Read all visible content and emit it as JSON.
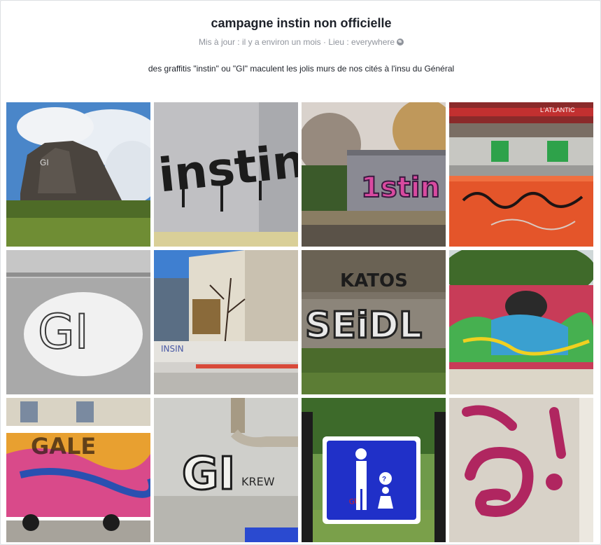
{
  "group": {
    "title": "campagne instin non officielle",
    "meta_updated": "Mis à jour : il y a environ un mois",
    "meta_separator": " · ",
    "meta_location": "Lieu : everywhere",
    "location_icon": "globe-icon",
    "description": "des graffitis \"instin\" ou \"GI\" maculent les jolis murs de nos cités à l'insu du Général"
  },
  "photos": {
    "p1": {
      "subject": "rock"
    },
    "p2": {
      "subject": "tag-instin",
      "tag": "instin"
    },
    "p3": {
      "subject": "wall-piece",
      "tag": "1stin"
    },
    "p4": {
      "subject": "barrier",
      "sign": "L'ATLANTIC"
    },
    "p5": {
      "subject": "gi-wall",
      "tag": "GI"
    },
    "p6": {
      "subject": "construction"
    },
    "p7": {
      "subject": "long-wall",
      "tag": "KATOS"
    },
    "p8": {
      "subject": "mural"
    },
    "p9": {
      "subject": "truck"
    },
    "p10": {
      "subject": "gi-krew",
      "tag": "GI",
      "tag2": "KREW"
    },
    "p11": {
      "subject": "sign"
    },
    "p12": {
      "subject": "pink-gi"
    }
  },
  "colors": {
    "title": "#1d2129",
    "meta": "#90949c",
    "card_border": "#dddfe2",
    "page_bg": "#e9ebee"
  }
}
